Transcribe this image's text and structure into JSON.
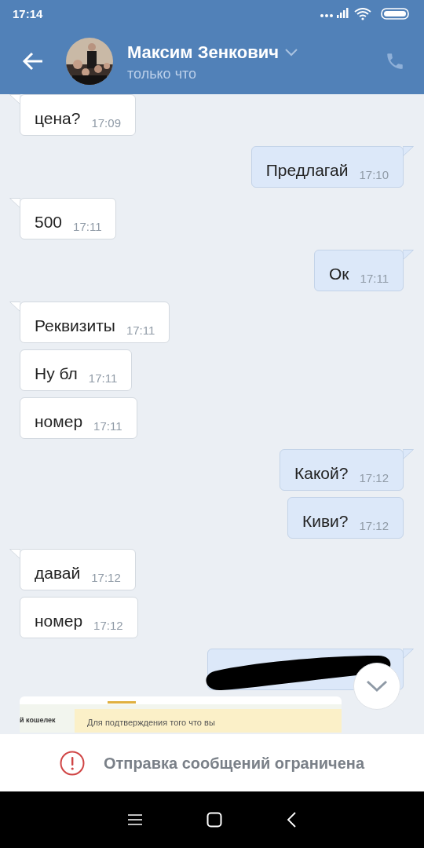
{
  "status_bar": {
    "time": "17:14"
  },
  "header": {
    "name": "Максим Зенкович",
    "subtitle": "только что"
  },
  "messages": [
    {
      "kind": "text",
      "outgoing": false,
      "tail": true,
      "text": "цена?",
      "time": "17:09"
    },
    {
      "kind": "text",
      "outgoing": true,
      "tail": true,
      "text": "Предлагай",
      "time": "17:10"
    },
    {
      "kind": "text",
      "outgoing": false,
      "tail": true,
      "text": "500",
      "time": "17:11"
    },
    {
      "kind": "text",
      "outgoing": true,
      "tail": true,
      "text": "Ок",
      "time": "17:11"
    },
    {
      "kind": "text",
      "outgoing": false,
      "tail": true,
      "text": "Реквизиты",
      "time": "17:11"
    },
    {
      "kind": "text",
      "outgoing": false,
      "tail": false,
      "text": "Ну бл",
      "time": "17:11"
    },
    {
      "kind": "text",
      "outgoing": false,
      "tail": false,
      "text": "номер",
      "time": "17:11"
    },
    {
      "kind": "text",
      "outgoing": true,
      "tail": true,
      "text": "Какой?",
      "time": "17:12"
    },
    {
      "kind": "text",
      "outgoing": true,
      "tail": false,
      "text": "Киви?",
      "time": "17:12"
    },
    {
      "kind": "text",
      "outgoing": false,
      "tail": true,
      "text": "давай",
      "time": "17:12"
    },
    {
      "kind": "text",
      "outgoing": false,
      "tail": false,
      "text": "номер",
      "time": "17:12"
    },
    {
      "kind": "redacted",
      "outgoing": true,
      "tail": true
    },
    {
      "kind": "screenshot",
      "outgoing": false,
      "tail": false,
      "sidebar_text": "й кошелек",
      "notice_text": "Для подтверждения того что вы"
    }
  ],
  "restriction_notice": "Отправка сообщений ограничена"
}
